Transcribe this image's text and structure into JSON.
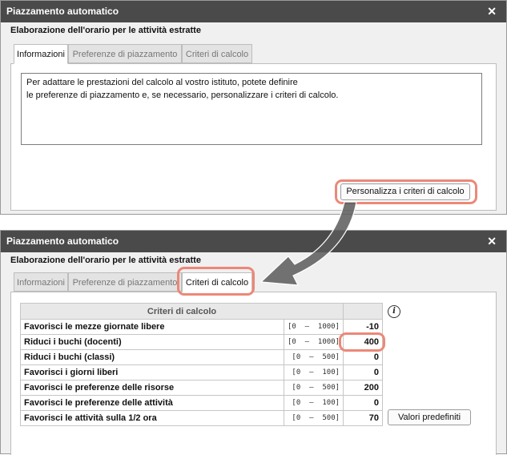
{
  "window": {
    "title": "Piazzamento automatico",
    "close_glyph": "✕"
  },
  "subtitle": "Elaborazione dell'orario per le attività estratte",
  "tabs": [
    {
      "label": "Informazioni"
    },
    {
      "label": "Preferenze di piazzamento"
    },
    {
      "label": "Criteri di calcolo"
    }
  ],
  "info_text": {
    "line1": "Per adattare le prestazioni del calcolo al vostro istituto, potete definire",
    "line2": "le preferenze di piazzamento e, se necessario, personalizzare i criteri di calcolo."
  },
  "customize_button": "Personalizza i criteri di calcolo",
  "criteria": {
    "header": "Criteri di calcolo",
    "rows": [
      {
        "label": "Favorisci le mezze giornate libere",
        "range": "[0  –  1000]",
        "value": "-10"
      },
      {
        "label": "Riduci i buchi (docenti)",
        "range": "[0  –  1000]",
        "value": "400"
      },
      {
        "label": "Riduci i buchi (classi)",
        "range": "[0  –  500]",
        "value": "0"
      },
      {
        "label": "Favorisci i giorni liberi",
        "range": "[0  –  100]",
        "value": "0"
      },
      {
        "label": "Favorisci le preferenze delle risorse",
        "range": "[0  –  500]",
        "value": "200"
      },
      {
        "label": "Favorisci le preferenze delle attività",
        "range": "[0  –  100]",
        "value": "0"
      },
      {
        "label": "Favorisci le attività sulla 1/2 ora",
        "range": "[0  –  500]",
        "value": "70"
      }
    ]
  },
  "defaults_button": "Valori predefiniti",
  "info_icon": "info-icon",
  "colors": {
    "titlebar": "#4a4a4a",
    "highlight": "#ec8878",
    "arrow": "#5a5a5a"
  }
}
